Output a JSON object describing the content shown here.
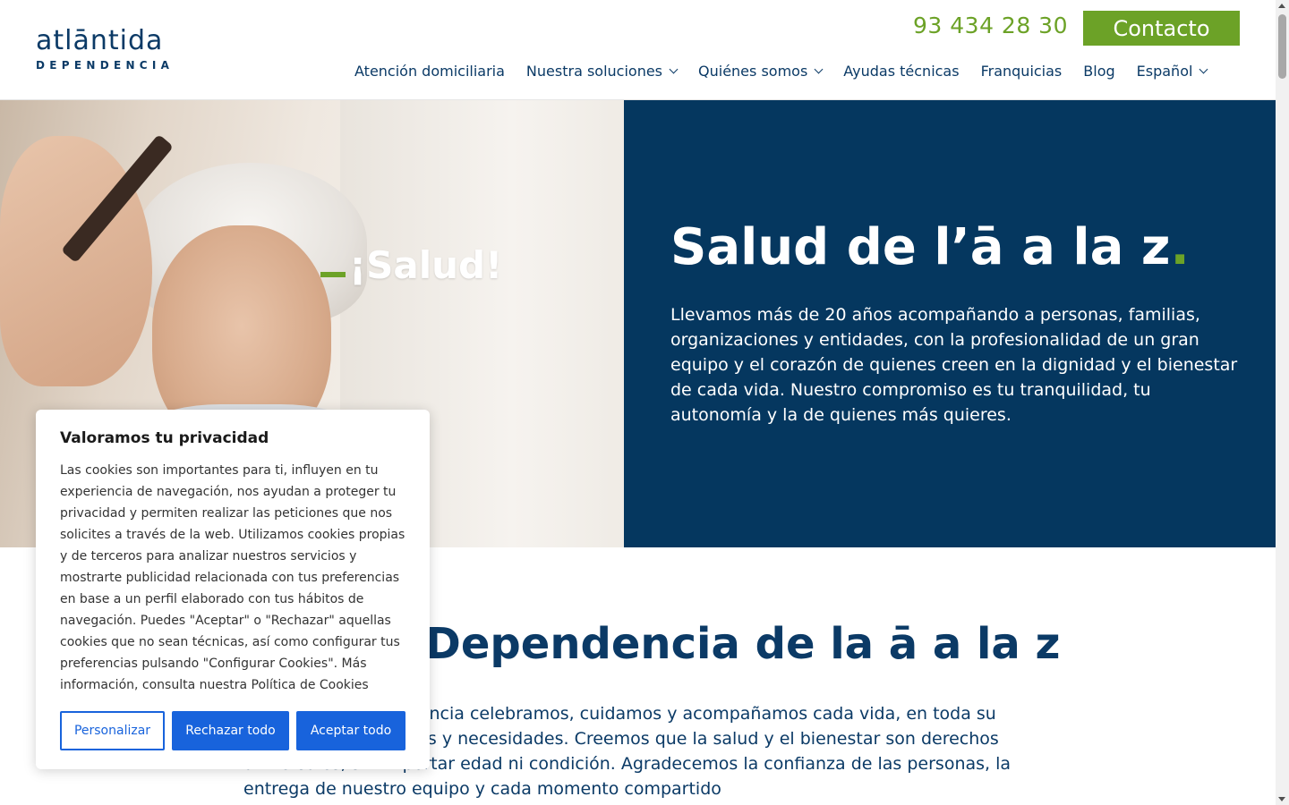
{
  "header": {
    "logo_main": "atlāntida",
    "logo_sub": "DEPENDENCIA",
    "phone": "93 434 28 30",
    "contact_label": "Contacto"
  },
  "nav": {
    "items": [
      {
        "label": "Atención domiciliaria",
        "dropdown": false
      },
      {
        "label": "Nuestra soluciones",
        "dropdown": true
      },
      {
        "label": "Quiénes somos",
        "dropdown": true
      },
      {
        "label": "Ayudas técnicas",
        "dropdown": false
      },
      {
        "label": "Franquicias",
        "dropdown": false
      },
      {
        "label": "Blog",
        "dropdown": false
      },
      {
        "label": "Español",
        "dropdown": true
      }
    ]
  },
  "hero": {
    "image_overlay_text": "¡Salud!",
    "title": "Salud de l’ā a la z",
    "title_dot": ".",
    "description": "Llevamos más de 20 años acompañando a personas, familias, organizaciones y entidades, con la profesionalidad de un gran equipo y el corazón de quienes creen en la dignidad y el bienestar de cada vida. Nuestro compromiso es tu tranquilidad, tu autonomía y la de quienes más quieres."
  },
  "section": {
    "title": "Dependencia de la ā a la z",
    "text": "En Atlántida Dependencia celebramos, cuidamos y acompañamos cada vida, en toda su diversidad de historias y necesidades. Creemos que la salud y el bienestar son derechos universales, sin importar edad ni condición. Agradecemos la confianza de las personas, la entrega de nuestro equipo y cada momento compartido"
  },
  "cookie": {
    "title": "Valoramos tu privacidad",
    "text": "Las cookies son importantes para ti, influyen en tu experiencia de navegación, nos ayudan a proteger tu privacidad y permiten realizar las peticiones que nos solicites a través de la web. Utilizamos cookies propias y de terceros para analizar nuestros servicios y mostrarte publicidad relacionada con tus preferencias en base a un perfil elaborado con tus hábitos de navegación. Puedes \"Aceptar\" o \"Rechazar\" aquellas cookies que no sean técnicas, así como configurar tus preferencias pulsando \"Configurar Cookies\". Más información, consulta nuestra Política de Cookies",
    "btn_customize": "Personalizar",
    "btn_reject": "Rechazar todo",
    "btn_accept": "Aceptar todo"
  },
  "colors": {
    "brand_blue": "#0b3a66",
    "hero_panel": "#05375f",
    "brand_green": "#6ca227",
    "cookie_button_blue": "#1863dc"
  },
  "icons": {
    "dropdown": "chevron-down-icon"
  }
}
